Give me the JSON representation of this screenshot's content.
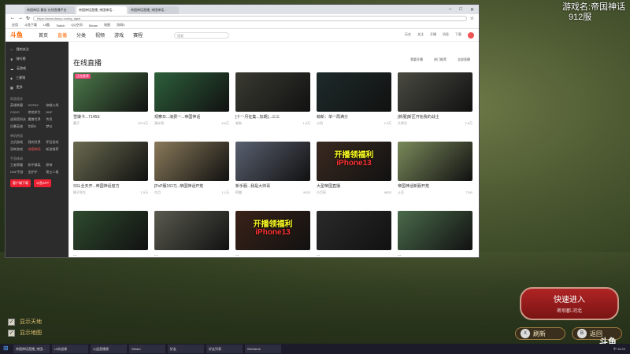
{
  "overlay": {
    "line1": "游戏名:帝国神话",
    "line2": "912服"
  },
  "browser": {
    "tabs": [
      "帝国神话·最佳·在线直播平台",
      "帝国神话直播_帝国神话...",
      "帝国神话直播_帝国神话..."
    ],
    "url": "https://www.douyu.com/g_dgsh",
    "bookmarks": [
      "应用",
      "斗鱼下载",
      "UI酷",
      "Twitch",
      "QQ空间",
      "Steam",
      "地图",
      "剑网3"
    ],
    "site_logo": "斗鱼",
    "nav": [
      "首页",
      "直播",
      "分类",
      "视频",
      "游戏",
      "赛程"
    ],
    "nav_active": "直播",
    "search_placeholder": "搜索",
    "header_icons": [
      "历史",
      "关注",
      "开播",
      "消息",
      "下载"
    ]
  },
  "sidebar": {
    "items": [
      "我的关注",
      "排行榜",
      "云游戏",
      "三星堆",
      "更多"
    ],
    "sections": [
      {
        "title": "网游竞技",
        "items": [
          "英雄联盟",
          "DOTA2",
          "穿越火线",
          "CSGO",
          "绝地求生",
          "DNF",
          "逃离塔科夫",
          "魔兽世界",
          "传奇",
          "风暴英雄",
          "剑网3",
          "梦幻"
        ]
      },
      {
        "title": "单机热游",
        "items": [
          "主机游戏",
          "我的世界",
          "怀旧游戏",
          "恐怖游戏",
          "帝国神话",
          "新游推荐"
        ]
      },
      {
        "title": "手游休闲",
        "items": [
          "王者荣耀",
          "和平精英",
          "原神",
          "DNF手游",
          "金铲铲",
          "第五人格"
        ]
      }
    ],
    "buttons": [
      "客户端下载",
      "斗鱼APP"
    ]
  },
  "main": {
    "heading": "在线直播",
    "tools": [
      "我要开播",
      "热门推荐",
      "全部直播"
    ],
    "cards": [
      {
        "title": "雪嫌卡...7145S",
        "host": "墨子",
        "heat": "2074万",
        "label": "正在推荐",
        "bg": "#4c7a4a"
      },
      {
        "title": "观察日...浪费一...帝国神话",
        "host": "清水哥",
        "heat": "6.6万",
        "label": "",
        "bg": "#2d5f3a"
      },
      {
        "title": "[十一月征集...加期]...三三",
        "host": "老狗",
        "heat": "1.8万",
        "label": "",
        "bg": "#3a3a32"
      },
      {
        "title": "萌新：单一局满分",
        "host": "小风",
        "heat": "2.9万",
        "label": "",
        "bg": "#1e2a2a"
      },
      {
        "title": "[新服]新区开始我的战士",
        "host": "大师兄",
        "heat": "2.6万",
        "label": "",
        "bg": "#4a4a42"
      },
      {
        "title": "SSL全天开...帝国神话官方",
        "host": "格子先生",
        "heat": "1.5万",
        "label": "",
        "bg": "#6a6a50"
      },
      {
        "title": "[PvP服1617]...帝国神话开荒",
        "host": "古月",
        "heat": "1.1万",
        "label": "",
        "bg": "#8a7a5a"
      },
      {
        "title": "新手服...我是大帅哥",
        "host": "阿猫",
        "heat": "9023",
        "label": "",
        "bg": "#5a6070"
      },
      {
        "title": "大型帝国直播",
        "host": "小月亮",
        "heat": "8832",
        "label": "",
        "bg": "#3a2a20",
        "promo1": "开播领福利",
        "promo2": "iPhone13"
      },
      {
        "title": "帝国神话新服开荒",
        "host": "土豆",
        "heat": "7760",
        "label": "",
        "bg": "#7a8a5a"
      },
      {
        "title": "...",
        "host": "",
        "heat": "",
        "label": "",
        "bg": "#2e4a2e"
      },
      {
        "title": "...",
        "host": "",
        "heat": "",
        "label": "",
        "bg": "#5a5a50"
      },
      {
        "title": "...",
        "host": "",
        "heat": "",
        "label": "",
        "bg": "#3a2218",
        "promo1": "开播领福利",
        "promo2": "iPhone13"
      },
      {
        "title": "...",
        "host": "",
        "heat": "",
        "label": "",
        "bg": "#2a2a2a"
      },
      {
        "title": "...",
        "host": "",
        "heat": "",
        "label": "",
        "bg": "#4a6a4a"
      }
    ]
  },
  "game": {
    "checks": [
      "显示天地",
      "显示地图"
    ],
    "quick_enter": "快速进入",
    "quick_server": "密坝郡-河北",
    "refresh": "刷新",
    "back": "返回",
    "logo": "斗鱼",
    "logo_sub": "DOUYU.COM"
  },
  "taskbar": {
    "items": [
      "帝国神话直播_帝国...",
      "UI实战课",
      "公益直播源",
      "Steam",
      "好友",
      "好友列表",
      "WeGame"
    ],
    "tray": "中 16:20"
  }
}
